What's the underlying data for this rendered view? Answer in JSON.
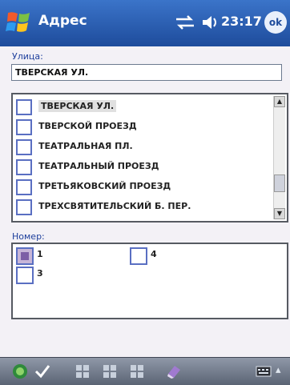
{
  "app": {
    "title": "Адрес",
    "clock": "23:17",
    "ok_label": "ok"
  },
  "street": {
    "label": "Улица:",
    "value": "ТВЕРСКАЯ УЛ.",
    "options": [
      "ТВЕРСКАЯ УЛ.",
      "ТВЕРСКОЙ ПРОЕЗД",
      "ТЕАТРАЛЬНАЯ ПЛ.",
      "ТЕАТРАЛЬНЫЙ ПРОЕЗД",
      "ТРЕТЬЯКОВСКИЙ ПРОЕЗД",
      "ТРЕХСВЯТИТЕЛЬСКИЙ Б. ПЕР."
    ]
  },
  "house": {
    "label": "Номер:",
    "items": [
      {
        "label": "1",
        "checked": true
      },
      {
        "label": "4",
        "checked": false
      },
      {
        "label": "3",
        "checked": false
      }
    ]
  },
  "menubar": {
    "icon_names": [
      "start-icon",
      "check-icon",
      "grid-icon",
      "grid-icon",
      "grid-icon",
      "eraser-icon",
      "keyboard-icon"
    ]
  }
}
